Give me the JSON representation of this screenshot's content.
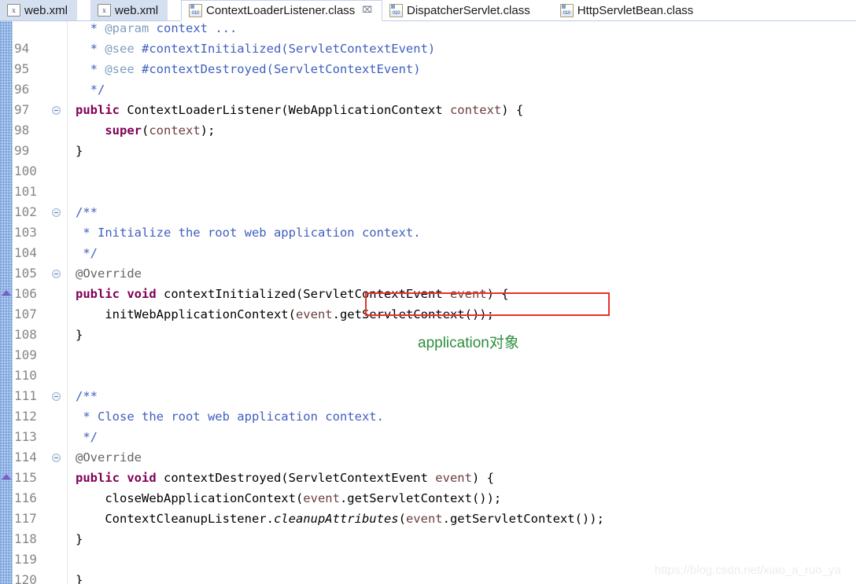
{
  "tabbar": {
    "tabs": [
      {
        "label": "web.xml",
        "icon": "xml-file-icon",
        "state": "inactive",
        "closable": false
      },
      {
        "label": "web.xml",
        "icon": "xml-file-icon",
        "state": "inactive",
        "closable": false
      },
      {
        "label": "ContextLoaderListener.class",
        "icon": "class-file-icon",
        "state": "active",
        "closable": true,
        "close_glyph": "⌧"
      },
      {
        "label": "DispatcherServlet.class",
        "icon": "class-file-icon",
        "state": "plain",
        "closable": false
      },
      {
        "label": "HttpServletBean.class",
        "icon": "class-file-icon",
        "state": "plain",
        "closable": false
      }
    ],
    "xml_icon_glyph": "x",
    "class_icon_bits": "010"
  },
  "editor": {
    "first_visible_line": 94,
    "last_visible_line": 120,
    "lines": [
      {
        "num": "",
        "fold": false,
        "override": false,
        "partial": true,
        "tokens": [
          {
            "t": "  * ",
            "c": "doc"
          },
          {
            "t": "@param",
            "c": "doctag"
          },
          {
            "t": " context ...",
            "c": "doc"
          }
        ]
      },
      {
        "num": "94",
        "fold": false,
        "override": false,
        "tokens": [
          {
            "t": "  * ",
            "c": "doc"
          },
          {
            "t": "@see",
            "c": "doctag"
          },
          {
            "t": " #contextInitialized(ServletContextEvent)",
            "c": "doc"
          }
        ]
      },
      {
        "num": "95",
        "fold": false,
        "override": false,
        "tokens": [
          {
            "t": "  * ",
            "c": "doc"
          },
          {
            "t": "@see",
            "c": "doctag"
          },
          {
            "t": " #contextDestroyed(ServletContextEvent)",
            "c": "doc"
          }
        ]
      },
      {
        "num": "96",
        "fold": false,
        "override": false,
        "tokens": [
          {
            "t": "  */",
            "c": "doc"
          }
        ]
      },
      {
        "num": "97",
        "fold": true,
        "override": false,
        "tokens": [
          {
            "t": "public",
            "c": "kw"
          },
          {
            "t": " ContextLoaderListener(WebApplicationContext ",
            "c": "pl"
          },
          {
            "t": "context",
            "c": "param"
          },
          {
            "t": ") {",
            "c": "pl"
          }
        ]
      },
      {
        "num": "98",
        "fold": false,
        "override": false,
        "tokens": [
          {
            "t": "    ",
            "c": "pl"
          },
          {
            "t": "super",
            "c": "kw"
          },
          {
            "t": "(",
            "c": "pl"
          },
          {
            "t": "context",
            "c": "param"
          },
          {
            "t": ");",
            "c": "pl"
          }
        ]
      },
      {
        "num": "99",
        "fold": false,
        "override": false,
        "tokens": [
          {
            "t": "}",
            "c": "pl"
          }
        ]
      },
      {
        "num": "100",
        "fold": false,
        "override": false,
        "tokens": []
      },
      {
        "num": "101",
        "fold": false,
        "override": false,
        "tokens": []
      },
      {
        "num": "102",
        "fold": true,
        "override": false,
        "tokens": [
          {
            "t": "/**",
            "c": "doc"
          }
        ]
      },
      {
        "num": "103",
        "fold": false,
        "override": false,
        "tokens": [
          {
            "t": " * Initialize the root web application context.",
            "c": "doc"
          }
        ]
      },
      {
        "num": "104",
        "fold": false,
        "override": false,
        "tokens": [
          {
            "t": " */",
            "c": "doc"
          }
        ]
      },
      {
        "num": "105",
        "fold": true,
        "override": false,
        "tokens": [
          {
            "t": "@Override",
            "c": "ann"
          }
        ]
      },
      {
        "num": "106",
        "fold": false,
        "override": true,
        "tokens": [
          {
            "t": "public",
            "c": "kw"
          },
          {
            "t": " ",
            "c": "pl"
          },
          {
            "t": "void",
            "c": "kw"
          },
          {
            "t": " contextInitialized(ServletContextEvent ",
            "c": "pl"
          },
          {
            "t": "event",
            "c": "param"
          },
          {
            "t": ") {",
            "c": "pl"
          }
        ]
      },
      {
        "num": "107",
        "fold": false,
        "override": false,
        "tokens": [
          {
            "t": "    initWebApplicationContext(",
            "c": "pl"
          },
          {
            "t": "event",
            "c": "param"
          },
          {
            "t": ".getServletContext());",
            "c": "pl"
          }
        ]
      },
      {
        "num": "108",
        "fold": false,
        "override": false,
        "tokens": [
          {
            "t": "}",
            "c": "pl"
          }
        ]
      },
      {
        "num": "109",
        "fold": false,
        "override": false,
        "tokens": []
      },
      {
        "num": "110",
        "fold": false,
        "override": false,
        "tokens": []
      },
      {
        "num": "111",
        "fold": true,
        "override": false,
        "tokens": [
          {
            "t": "/**",
            "c": "doc"
          }
        ]
      },
      {
        "num": "112",
        "fold": false,
        "override": false,
        "tokens": [
          {
            "t": " * Close the root web application context.",
            "c": "doc"
          }
        ]
      },
      {
        "num": "113",
        "fold": false,
        "override": false,
        "tokens": [
          {
            "t": " */",
            "c": "doc"
          }
        ]
      },
      {
        "num": "114",
        "fold": true,
        "override": false,
        "tokens": [
          {
            "t": "@Override",
            "c": "ann"
          }
        ]
      },
      {
        "num": "115",
        "fold": false,
        "override": true,
        "tokens": [
          {
            "t": "public",
            "c": "kw"
          },
          {
            "t": " ",
            "c": "pl"
          },
          {
            "t": "void",
            "c": "kw"
          },
          {
            "t": " contextDestroyed(ServletContextEvent ",
            "c": "pl"
          },
          {
            "t": "event",
            "c": "param"
          },
          {
            "t": ") {",
            "c": "pl"
          }
        ]
      },
      {
        "num": "116",
        "fold": false,
        "override": false,
        "tokens": [
          {
            "t": "    closeWebApplicationContext(",
            "c": "pl"
          },
          {
            "t": "event",
            "c": "param"
          },
          {
            "t": ".getServletContext());",
            "c": "pl"
          }
        ]
      },
      {
        "num": "117",
        "fold": false,
        "override": false,
        "tokens": [
          {
            "t": "    ContextCleanupListener.",
            "c": "pl"
          },
          {
            "t": "cleanupAttributes",
            "c": "stat"
          },
          {
            "t": "(",
            "c": "pl"
          },
          {
            "t": "event",
            "c": "param"
          },
          {
            "t": ".getServletContext());",
            "c": "pl"
          }
        ]
      },
      {
        "num": "118",
        "fold": false,
        "override": false,
        "tokens": [
          {
            "t": "}",
            "c": "pl"
          }
        ]
      },
      {
        "num": "119",
        "fold": false,
        "override": false,
        "tokens": []
      },
      {
        "num": "120",
        "fold": false,
        "override": false,
        "tokens": [
          {
            "t": "}",
            "c": "pl"
          }
        ]
      }
    ]
  },
  "annotations": {
    "highlight_box": {
      "label": "event.getServletContext()",
      "color": "#e8322a"
    },
    "note": {
      "text": "application对象",
      "color": "#2f8f3f"
    }
  },
  "watermark": {
    "text": "https://blog.csdn.net/xiao_a_ruo_ya"
  },
  "colors": {
    "keyword": "#7f0055",
    "javadoc": "#3f5fbf",
    "javadoc_tag": "#7f9fbf",
    "annotation": "#646464",
    "parameter": "#6a3e3e",
    "line_number": "#868686",
    "tab_inactive_bg": "#d4dff0",
    "editor_bg": "#ffffff"
  }
}
